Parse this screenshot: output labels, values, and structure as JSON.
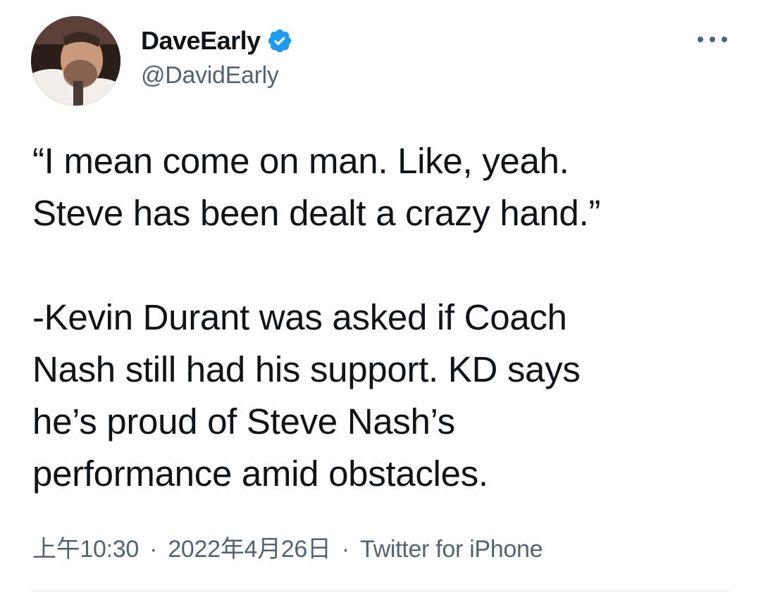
{
  "author": {
    "display_name": "DaveEarly",
    "handle": "@DavidEarly",
    "verified": true
  },
  "tweet": {
    "lines": [
      "“I mean come on man. Like, yeah.",
      "Steve has been dealt a crazy hand.”",
      "-Kevin Durant was asked if Coach",
      "Nash still had his support. KD says",
      "he’s proud of Steve Nash’s",
      "performance amid obstacles."
    ]
  },
  "meta": {
    "time": "上午10:30",
    "date": "2022年4月26日",
    "source": "Twitter for iPhone",
    "separator": "·"
  },
  "colors": {
    "text": "#0f1419",
    "secondary": "#536471",
    "verified_badge": "#1d9bf0"
  },
  "icons": {
    "verified": "verified-badge-icon",
    "more": "more-options-icon"
  }
}
